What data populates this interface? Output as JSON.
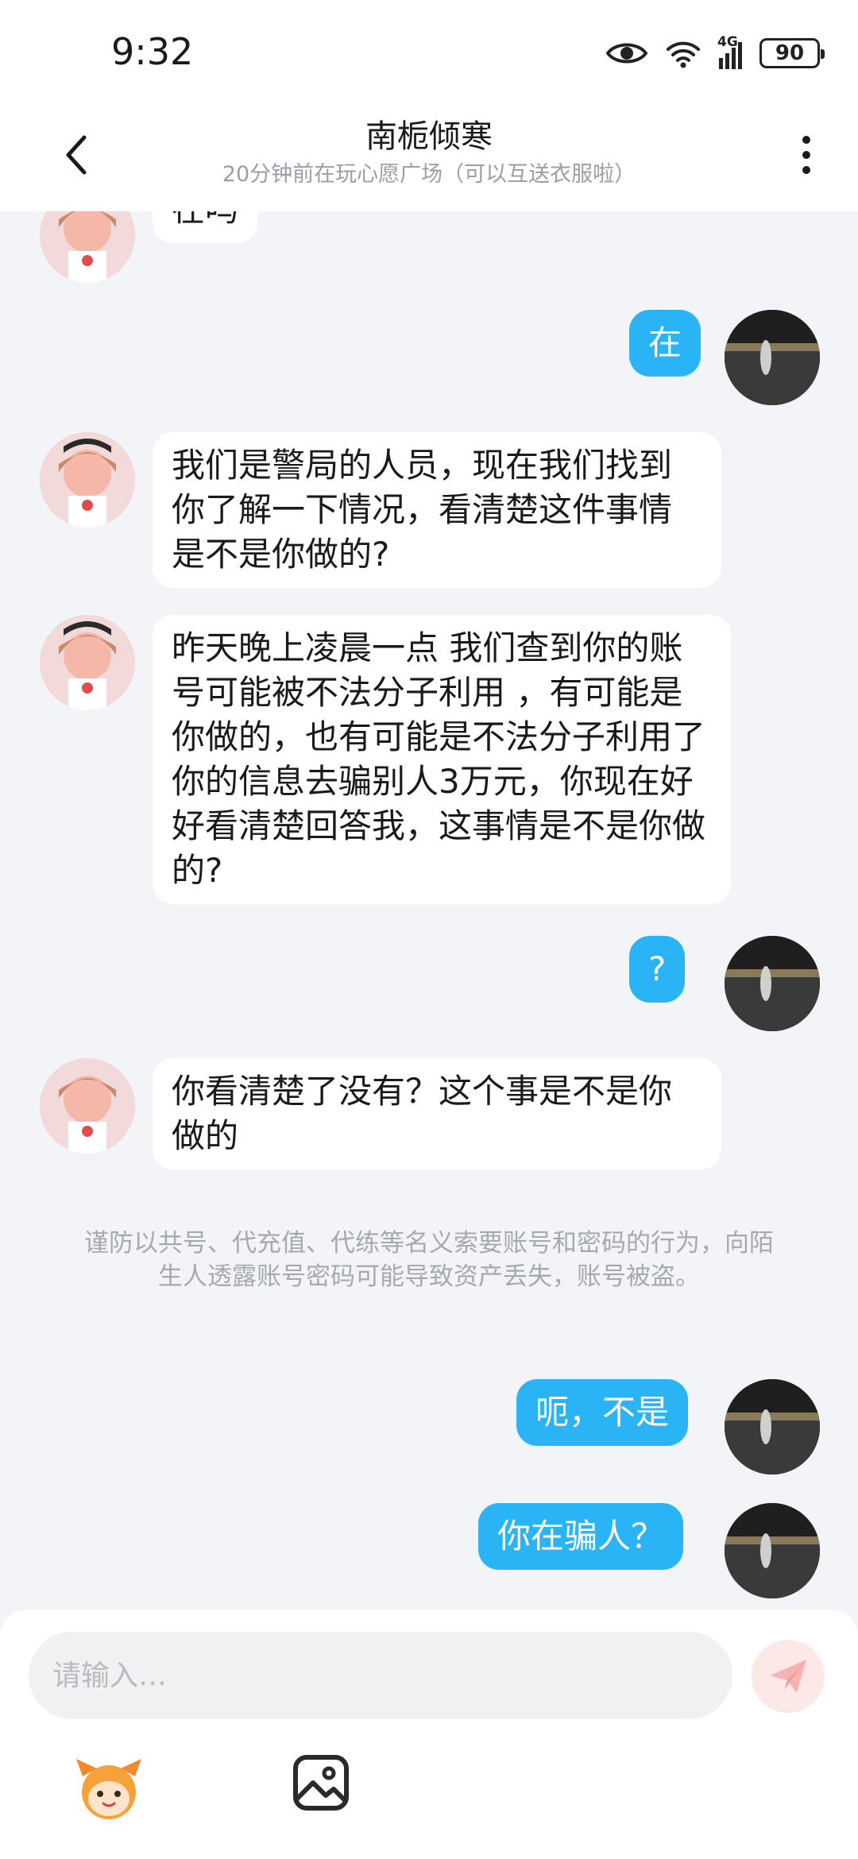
{
  "status_bar": {
    "time": "9:32",
    "network": "4G",
    "battery": "90"
  },
  "header": {
    "contact_name": "南栀倾寒",
    "contact_status": "20分钟前在玩心愿广场（可以互送衣服啦）"
  },
  "messages": [
    {
      "from": "other",
      "text": "在吗"
    },
    {
      "from": "self",
      "text": "在"
    },
    {
      "from": "other",
      "text": "我们是警局的人员，现在我们找到你了解一下情况，看清楚这件事情是不是你做的?"
    },
    {
      "from": "other",
      "text": "昨天晚上凌晨一点 我们查到你的账号可能被不法分子利用 ，有可能是你做的，也有可能是不法分子利用了你的信息去骗别人3万元，你现在好好看清楚回答我，这事情是不是你做的?"
    },
    {
      "from": "self",
      "text": "?"
    },
    {
      "from": "other",
      "text": "你看清楚了没有？这个事是不是你做的"
    },
    {
      "from": "self",
      "text": "呃，不是"
    },
    {
      "from": "self",
      "text": "你在骗人？"
    }
  ],
  "notice": "谨防以共号、代充值、代练等名义索要账号和密码的行为，向陌生人透露账号密码可能导致资产丢失，账号被盗。",
  "input": {
    "placeholder": "请输入…"
  },
  "icons": {
    "back": "chevron-left-icon",
    "more": "more-vertical-icon",
    "send": "paper-plane-icon",
    "sticker": "mascot-sticker-icon",
    "image": "image-icon"
  },
  "colors": {
    "self_bubble": "#2bb4f5",
    "other_bubble": "#ffffff",
    "background": "#f2f4f7"
  }
}
